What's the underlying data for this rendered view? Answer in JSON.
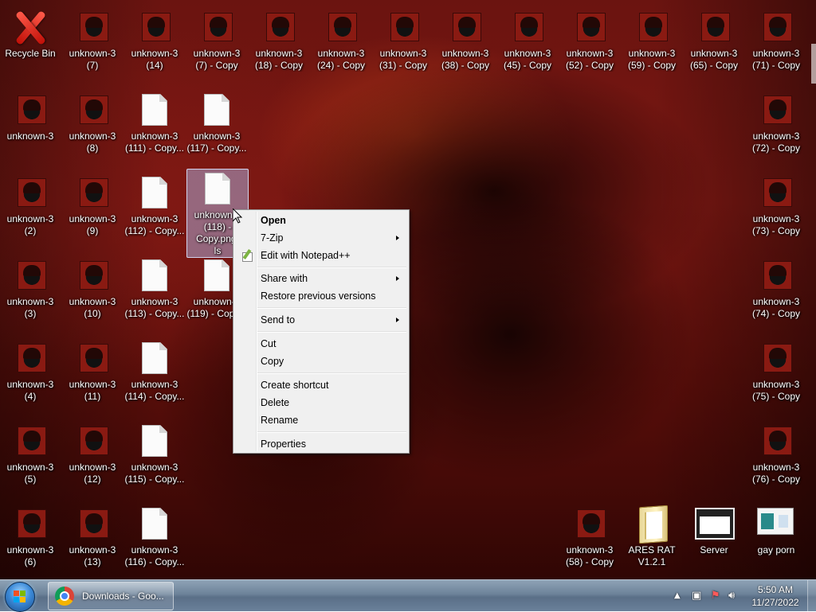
{
  "desktop": {
    "icons": [
      {
        "label": "Recycle Bin",
        "kind": "recycle"
      },
      {
        "label": "unknown-3\n(7)",
        "kind": "thumb"
      },
      {
        "label": "unknown-3\n(14)",
        "kind": "thumb"
      },
      {
        "label": "unknown-3\n(7) - Copy",
        "kind": "thumb"
      },
      {
        "label": "unknown-3\n(18) - Copy",
        "kind": "thumb"
      },
      {
        "label": "unknown-3\n(24) - Copy",
        "kind": "thumb"
      },
      {
        "label": "unknown-3\n(31) - Copy",
        "kind": "thumb"
      },
      {
        "label": "unknown-3\n(38) - Copy",
        "kind": "thumb"
      },
      {
        "label": "unknown-3\n(45) - Copy",
        "kind": "thumb"
      },
      {
        "label": "unknown-3\n(52) - Copy",
        "kind": "thumb"
      },
      {
        "label": "unknown-3\n(59) - Copy",
        "kind": "thumb"
      },
      {
        "label": "unknown-3\n(65) - Copy",
        "kind": "thumb"
      },
      {
        "label": "unknown-3\n(71) - Copy",
        "kind": "thumb"
      },
      {
        "label": "unknown-3",
        "kind": "thumb"
      },
      {
        "label": "unknown-3\n(8)",
        "kind": "thumb"
      },
      {
        "label": "unknown-3\n(111) - Copy...",
        "kind": "doc"
      },
      {
        "label": "unknown-3\n(117) - Copy...",
        "kind": "doc"
      },
      {
        "label": "unknown-3\n(72) - Copy",
        "kind": "thumb"
      },
      {
        "label": "unknown-3\n(2)",
        "kind": "thumb"
      },
      {
        "label": "unknown-3\n(9)",
        "kind": "thumb"
      },
      {
        "label": "unknown-3\n(112) - Copy...",
        "kind": "doc"
      },
      {
        "label": "unknown-3\n(118) -\nCopy.png.\nls",
        "kind": "doc",
        "selected": true
      },
      {
        "label": "unknown-3\n(73) - Copy",
        "kind": "thumb"
      },
      {
        "label": "unknown-3\n(3)",
        "kind": "thumb"
      },
      {
        "label": "unknown-3\n(10)",
        "kind": "thumb"
      },
      {
        "label": "unknown-3\n(113) - Copy...",
        "kind": "doc"
      },
      {
        "label": "unknown-3\n(119) - Copy...",
        "kind": "doc"
      },
      {
        "label": "unknown-3\n(74) - Copy",
        "kind": "thumb"
      },
      {
        "label": "unknown-3\n(4)",
        "kind": "thumb"
      },
      {
        "label": "unknown-3\n(11)",
        "kind": "thumb"
      },
      {
        "label": "unknown-3\n(114) - Copy...",
        "kind": "doc"
      },
      {
        "label": "unknown-3\n(75) - Copy",
        "kind": "thumb"
      },
      {
        "label": "unknown-3\n(5)",
        "kind": "thumb"
      },
      {
        "label": "unknown-3\n(12)",
        "kind": "thumb"
      },
      {
        "label": "unknown-3\n(115) - Copy...",
        "kind": "doc"
      },
      {
        "label": "unknown-3\n(76) - Copy",
        "kind": "thumb"
      },
      {
        "label": "unknown-3\n(6)",
        "kind": "thumb"
      },
      {
        "label": "unknown-3\n(13)",
        "kind": "thumb"
      },
      {
        "label": "unknown-3\n(116) - Copy...",
        "kind": "doc"
      },
      {
        "label": "unknown-3\n(58) - Copy",
        "kind": "thumb"
      },
      {
        "label": "ARES RAT\nV1.2.1",
        "kind": "folder"
      },
      {
        "label": "Server",
        "kind": "window"
      },
      {
        "label": "gay porn",
        "kind": "screenshot"
      }
    ]
  },
  "context_menu": {
    "open": "Open",
    "seven_zip": "7-Zip",
    "edit_notepad": "Edit with Notepad++",
    "share_with": "Share with",
    "restore_versions": "Restore previous versions",
    "send_to": "Send to",
    "cut": "Cut",
    "copy": "Copy",
    "create_shortcut": "Create shortcut",
    "delete": "Delete",
    "rename": "Rename",
    "properties": "Properties"
  },
  "taskbar": {
    "chrome_label": "Downloads - Goo...",
    "clock_time": "5:50 AM",
    "clock_date": "11/27/2022",
    "tray_icons": [
      "show-hidden-icons-icon",
      "network-icon",
      "action-center-icon",
      "volume-icon"
    ]
  },
  "colors": {
    "menu_bg": "#f0f0f0",
    "taskbar": "#6c8299",
    "selection": "#b4c8ff"
  }
}
